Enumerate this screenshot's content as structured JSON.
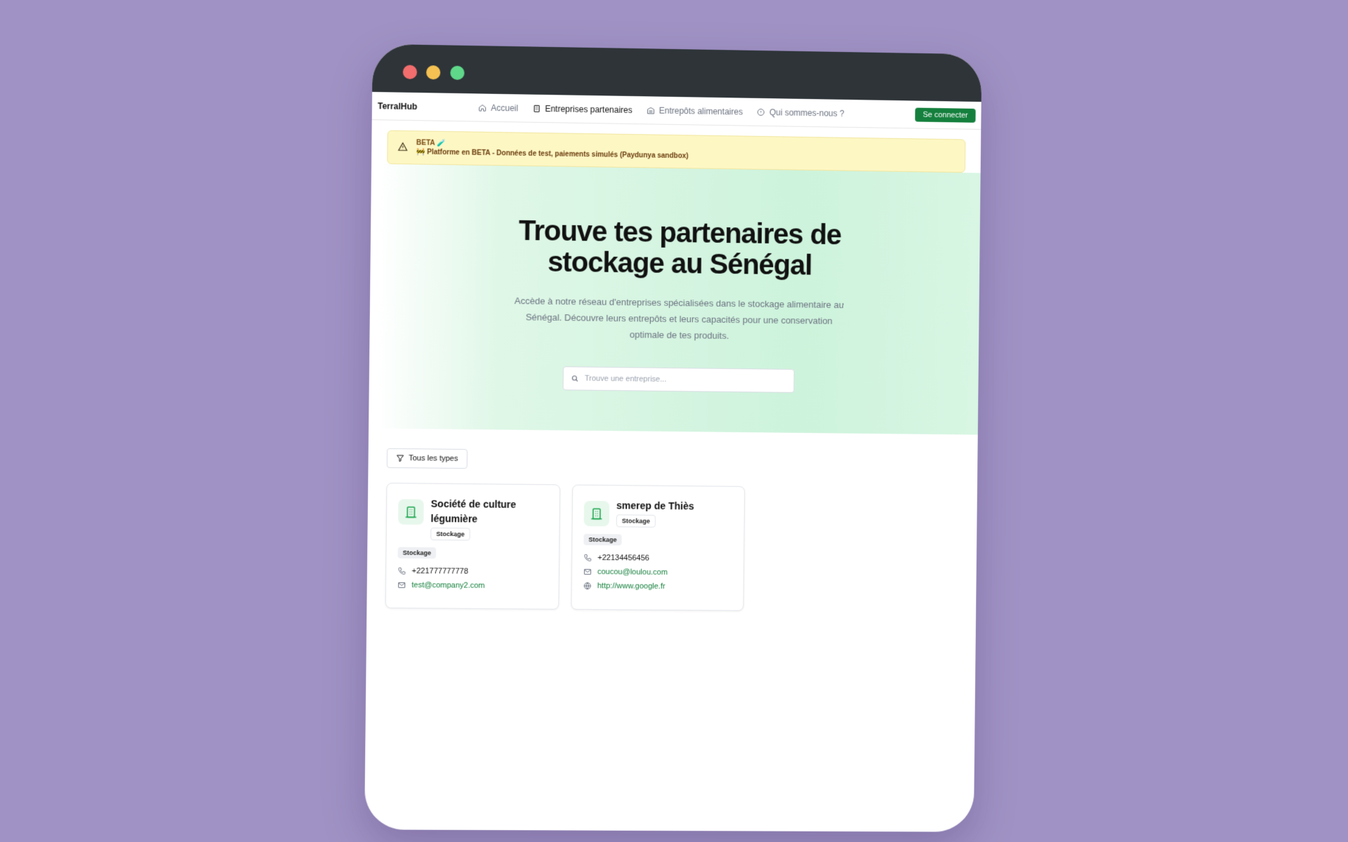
{
  "brand": "TerralHub",
  "nav": [
    {
      "label": "Accueil",
      "icon": "home-icon"
    },
    {
      "label": "Entreprises partenaires",
      "icon": "building-icon"
    },
    {
      "label": "Entrepôts alimentaires",
      "icon": "warehouse-icon"
    },
    {
      "label": "Qui sommes-nous ?",
      "icon": "info-icon"
    }
  ],
  "login_label": "Se connecter",
  "beta": {
    "title": "BETA 🧪",
    "text": "🚧 Platforme en BETA - Données de test, paiements simulés (Paydunya sandbox)"
  },
  "hero": {
    "title_line1": "Trouve tes partenaires de",
    "title_line2": "stockage au Sénégal",
    "description": "Accède à notre réseau d'entreprises spécialisées dans le stockage alimentaire au Sénégal. Découvre leurs entrepôts et leurs capacités pour une conservation optimale de tes produits.",
    "search_placeholder": "Trouve une entreprise..."
  },
  "filter_label": "Tous les types",
  "companies": [
    {
      "name_line1": "Société de culture",
      "name_line2": "légumière",
      "type_badge": "Stockage",
      "category": "Stockage",
      "phone": "+221777777778",
      "email": "test@company2.com"
    },
    {
      "name": "smerep de Thiès",
      "type_badge": "Stockage",
      "category": "Stockage",
      "phone": "+22134456456",
      "email": "coucou@loulou.com",
      "website": "http://www.google.fr"
    }
  ],
  "colors": {
    "accent": "#15803d",
    "background": "#a092c4",
    "titlebar": "#2e3438",
    "beta_bg": "#fdf7c4"
  }
}
